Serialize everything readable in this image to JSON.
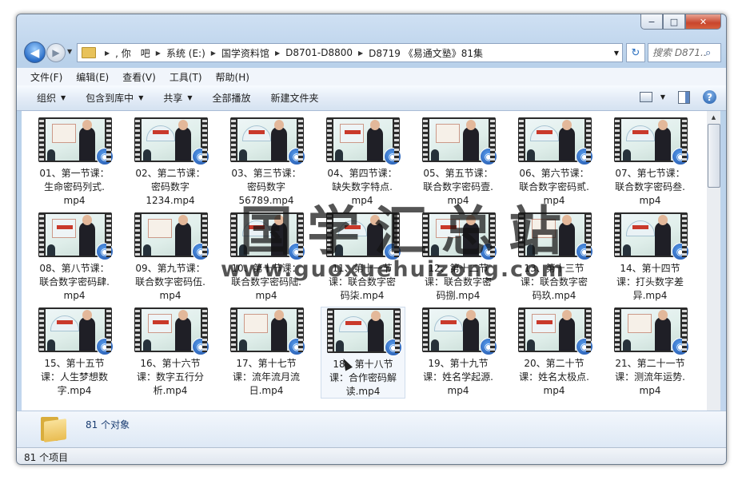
{
  "window": {
    "caption_buttons": {
      "minimize": "−",
      "maximize": "□",
      "close": "✕"
    }
  },
  "address": {
    "crumbs": [
      ", 你　吧",
      "系统 (E:)",
      "国学资料馆",
      "D8701-D8800",
      "D8719 《易通文塾》81集"
    ],
    "first_crumb": "«"
  },
  "search": {
    "placeholder": "搜索 D871..."
  },
  "menu": [
    "文件(F)",
    "编辑(E)",
    "查看(V)",
    "工具(T)",
    "帮助(H)"
  ],
  "toolbar": {
    "organize": "组织",
    "include_library": "包含到库中",
    "share": "共享",
    "play_all": "全部播放",
    "new_folder": "新建文件夹"
  },
  "files": [
    {
      "name": "01、第一节课：生命密码列式.mp4",
      "lines": [
        "01、第一节课：",
        "生命密码列式.",
        "mp4"
      ]
    },
    {
      "name": "02、第二节课：密码数字1234.mp4",
      "lines": [
        "02、第二节课：",
        "密码数字",
        "1234.mp4"
      ]
    },
    {
      "name": "03、第三节课：密码数字56789.mp4",
      "lines": [
        "03、第三节课：",
        "密码数字",
        "56789.mp4"
      ]
    },
    {
      "name": "04、第四节课：缺失数字特点.mp4",
      "lines": [
        "04、第四节课：",
        "缺失数字特点.",
        "mp4"
      ]
    },
    {
      "name": "05、第五节课：联合数字密码壹.mp4",
      "lines": [
        "05、第五节课：",
        "联合数字密码壹.",
        "mp4"
      ]
    },
    {
      "name": "06、第六节课：联合数字密码贰.mp4",
      "lines": [
        "06、第六节课：",
        "联合数字密码贰.",
        "mp4"
      ]
    },
    {
      "name": "07、第七节课：联合数字密码叁.mp4",
      "lines": [
        "07、第七节课：",
        "联合数字密码叁.",
        "mp4"
      ]
    },
    {
      "name": "08、第八节课：联合数字密码肆.mp4",
      "lines": [
        "08、第八节课：",
        "联合数字密码肆.",
        "mp4"
      ]
    },
    {
      "name": "09、第九节课：联合数字密码伍.mp4",
      "lines": [
        "09、第九节课：",
        "联合数字密码伍.",
        "mp4"
      ]
    },
    {
      "name": "10、第十节课：联合数字密码陆.mp4",
      "lines": [
        "10、第十节课：",
        "联合数字密码陆.",
        "mp4"
      ]
    },
    {
      "name": "11、第十一节课：联合数字密码柒.mp4",
      "lines": [
        "11、第十一节",
        "课：联合数字密",
        "码柒.mp4"
      ]
    },
    {
      "name": "12、第十二节课：联合数字密码捌.mp4",
      "lines": [
        "12、第十二节",
        "课：联合数字密",
        "码捌.mp4"
      ]
    },
    {
      "name": "13、第十三节课：联合数字密码玖.mp4",
      "lines": [
        "13、第十三节",
        "课：联合数字密",
        "码玖.mp4"
      ]
    },
    {
      "name": "14、第十四节课：打头数字差异.mp4",
      "lines": [
        "14、第十四节",
        "课：打头数字差",
        "异.mp4"
      ]
    },
    {
      "name": "15、第十五节课：人生梦想数字.mp4",
      "lines": [
        "15、第十五节",
        "课：人生梦想数",
        "字.mp4"
      ]
    },
    {
      "name": "16、第十六节课：数字五行分析.mp4",
      "lines": [
        "16、第十六节",
        "课：数字五行分",
        "析.mp4"
      ]
    },
    {
      "name": "17、第十七节课：流年流月流日.mp4",
      "lines": [
        "17、第十七节",
        "课：流年流月流",
        "日.mp4"
      ]
    },
    {
      "name": "18、第十八节课：合作密码解读.mp4",
      "lines": [
        "18、第十八节",
        "课：合作密码解",
        "读.mp4"
      ]
    },
    {
      "name": "19、第十九节课：姓名学起源.mp4",
      "lines": [
        "19、第十九节",
        "课：姓名学起源.",
        "mp4"
      ]
    },
    {
      "name": "20、第二十节课：姓名太极点.mp4",
      "lines": [
        "20、第二十节",
        "课：姓名太极点.",
        "mp4"
      ]
    },
    {
      "name": "21、第二十一节课：测流年运势.mp4",
      "lines": [
        "21、第二十一节",
        "课：测流年运势.",
        "mp4"
      ]
    }
  ],
  "selected_index": 17,
  "details": {
    "count": "81 个对象"
  },
  "status": {
    "items": "81 个项目"
  },
  "watermark": {
    "cn": "国学汇总站",
    "url": "www.guoxuehuizong.com"
  },
  "colors": {
    "badge": "#1d4fa5",
    "close": "#c8452c",
    "accent": "#1a3d72"
  }
}
